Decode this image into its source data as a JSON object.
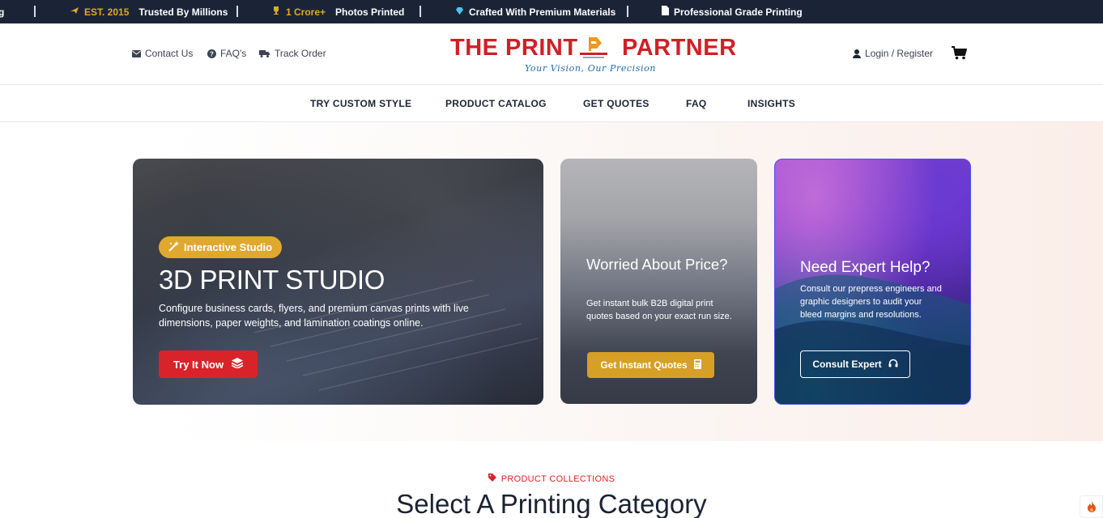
{
  "ticker": {
    "items": [
      {
        "icon": "plane-icon",
        "highlight": "EST. 2015",
        "text": "Trusted By Millions"
      },
      {
        "icon": "trophy-icon",
        "highlight": "1 Crore+",
        "text": "Photos Printed"
      },
      {
        "icon": "diamond-icon",
        "text": "Crafted With Premium Materials"
      },
      {
        "icon": "document-icon",
        "text": "Professional Grade Printing"
      }
    ],
    "leading_fragment": "g"
  },
  "header": {
    "contact": "Contact Us",
    "faqs": "FAQ's",
    "track": "Track Order",
    "brand_left": "THE PRINT",
    "brand_right": "PARTNER",
    "tagline": "Your Vision, Our Precision",
    "login": "Login / Register"
  },
  "nav": {
    "items": [
      "TRY CUSTOM STYLE",
      "PRODUCT CATALOG",
      "GET QUOTES",
      "FAQ",
      "INSIGHTS"
    ]
  },
  "hero": {
    "main": {
      "badge": "Interactive Studio",
      "title": "3D PRINT STUDIO",
      "description": "Configure business cards, flyers, and premium canvas prints with live dimensions, paper weights, and lamination coatings online.",
      "button": "Try It Now"
    },
    "price": {
      "title": "Worried About Price?",
      "description": "Get instant bulk B2B digital print quotes based on your exact run size.",
      "button": "Get Instant Quotes"
    },
    "expert": {
      "title": "Need Expert Help?",
      "description": "Consult our prepress engineers and graphic designers to audit your bleed margins and resolutions.",
      "button": "Consult Expert"
    }
  },
  "collections": {
    "eyebrow": "PRODUCT COLLECTIONS",
    "title": "Select A Printing Category"
  },
  "colors": {
    "brand_red": "#d11f25",
    "gold": "#e0a82e",
    "navy": "#1b2437",
    "accent_blue": "#1d6fb0"
  }
}
